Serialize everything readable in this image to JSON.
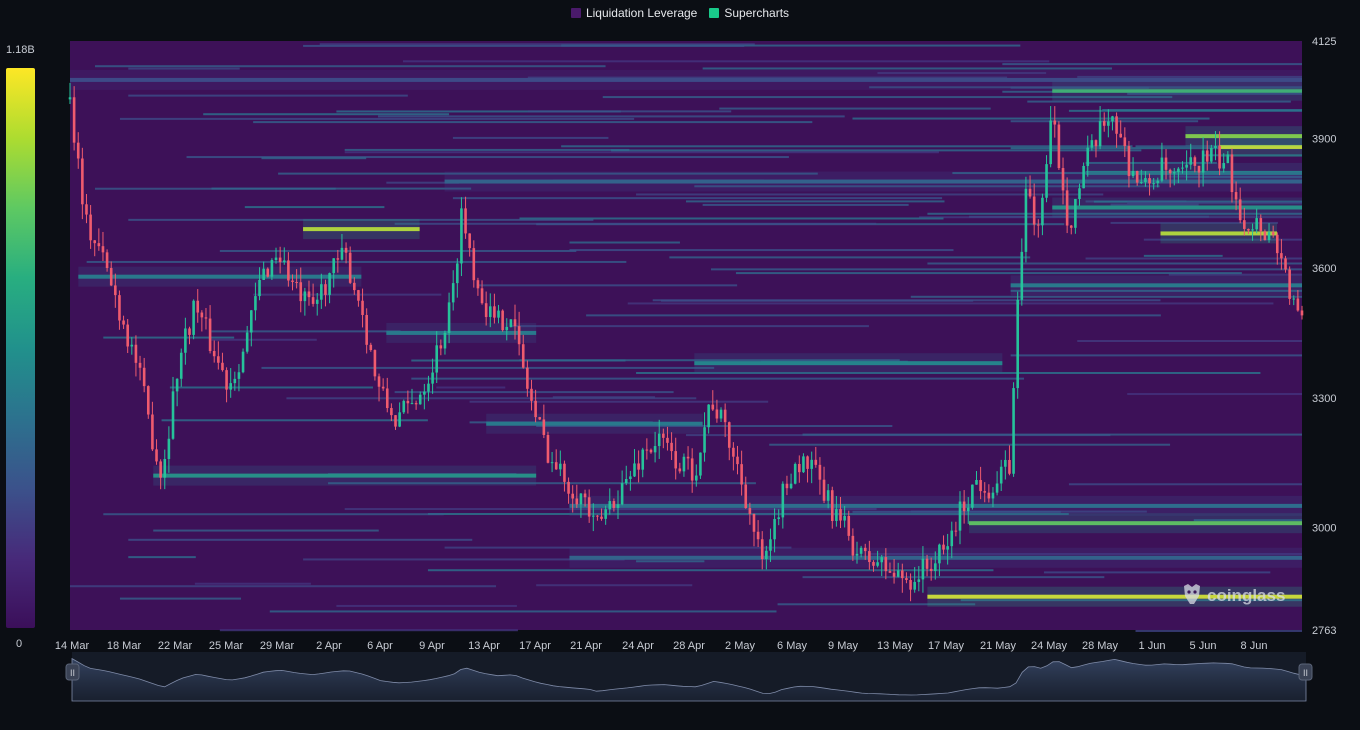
{
  "legend": {
    "items": [
      {
        "label": "Liquidation Leverage",
        "color": "#4a1a6b"
      },
      {
        "label": "Supercharts",
        "color": "#19c98a"
      }
    ]
  },
  "colorbar": {
    "max_label": "1.18B",
    "min_label": "0",
    "stops": [
      "#3b0f5a",
      "#472a7a",
      "#3b528b",
      "#2c728e",
      "#21918c",
      "#28ae80",
      "#5ec962",
      "#addc30",
      "#fde725"
    ]
  },
  "watermark": "coinglass",
  "navigator": {
    "left_handle": "II",
    "right_handle": "II"
  },
  "chart_data": {
    "type": "heatmap",
    "title": "",
    "ylim": [
      2763,
      4125
    ],
    "y_ticks": [
      "4125",
      "3900",
      "3600",
      "3300",
      "3000",
      "2763"
    ],
    "x_ticks": [
      "14 Mar",
      "18 Mar",
      "22 Mar",
      "25 Mar",
      "29 Mar",
      "2 Apr",
      "6 Apr",
      "9 Apr",
      "13 Apr",
      "17 Apr",
      "21 Apr",
      "24 Apr",
      "28 Apr",
      "2 May",
      "6 May",
      "9 May",
      "13 May",
      "17 May",
      "21 May",
      "24 May",
      "28 May",
      "1 Jun",
      "5 Jun",
      "8 Jun"
    ],
    "price_path": [
      [
        0,
        3990
      ],
      [
        2,
        3700
      ],
      [
        4,
        3620
      ],
      [
        6,
        3500
      ],
      [
        8,
        3380
      ],
      [
        10,
        3200
      ],
      [
        11,
        3120
      ],
      [
        13,
        3380
      ],
      [
        15,
        3520
      ],
      [
        17,
        3420
      ],
      [
        19,
        3330
      ],
      [
        21,
        3420
      ],
      [
        23,
        3580
      ],
      [
        25,
        3640
      ],
      [
        27,
        3550
      ],
      [
        29,
        3500
      ],
      [
        31,
        3580
      ],
      [
        33,
        3630
      ],
      [
        35,
        3510
      ],
      [
        37,
        3320
      ],
      [
        39,
        3250
      ],
      [
        41,
        3280
      ],
      [
        43,
        3350
      ],
      [
        45,
        3460
      ],
      [
        46,
        3540
      ],
      [
        47,
        3730
      ],
      [
        49,
        3560
      ],
      [
        51,
        3470
      ],
      [
        53,
        3500
      ],
      [
        54,
        3400
      ],
      [
        56,
        3250
      ],
      [
        58,
        3150
      ],
      [
        60,
        3100
      ],
      [
        62,
        3060
      ],
      [
        63,
        2990
      ],
      [
        65,
        3060
      ],
      [
        67,
        3110
      ],
      [
        69,
        3180
      ],
      [
        71,
        3200
      ],
      [
        73,
        3150
      ],
      [
        75,
        3130
      ],
      [
        77,
        3300
      ],
      [
        79,
        3210
      ],
      [
        81,
        3090
      ],
      [
        83,
        2920
      ],
      [
        84,
        2930
      ],
      [
        85,
        3040
      ],
      [
        87,
        3150
      ],
      [
        89,
        3140
      ],
      [
        91,
        3060
      ],
      [
        93,
        3000
      ],
      [
        95,
        2930
      ],
      [
        97,
        2920
      ],
      [
        99,
        2890
      ],
      [
        101,
        2880
      ],
      [
        103,
        2910
      ],
      [
        105,
        2940
      ],
      [
        107,
        3040
      ],
      [
        109,
        3110
      ],
      [
        111,
        3090
      ],
      [
        113,
        3150
      ],
      [
        114,
        3590
      ],
      [
        115,
        3800
      ],
      [
        116,
        3680
      ],
      [
        117,
        3780
      ],
      [
        118,
        3950
      ],
      [
        120,
        3700
      ],
      [
        122,
        3840
      ],
      [
        124,
        3920
      ],
      [
        125,
        3970
      ],
      [
        127,
        3850
      ],
      [
        129,
        3780
      ],
      [
        131,
        3830
      ],
      [
        133,
        3800
      ],
      [
        135,
        3840
      ],
      [
        137,
        3860
      ],
      [
        139,
        3840
      ],
      [
        141,
        3710
      ],
      [
        143,
        3700
      ],
      [
        145,
        3660
      ],
      [
        147,
        3510
      ],
      [
        148,
        3470
      ]
    ],
    "liquidation_levels": [
      {
        "price": 3880,
        "day_from": 138,
        "day_to": 148,
        "intensity": 0.98
      },
      {
        "price": 3905,
        "day_from": 134,
        "day_to": 148,
        "intensity": 0.85
      },
      {
        "price": 3690,
        "day_from": 28,
        "day_to": 42,
        "intensity": 0.95
      },
      {
        "price": 3680,
        "day_from": 131,
        "day_to": 145,
        "intensity": 0.95
      },
      {
        "price": 2840,
        "day_from": 103,
        "day_to": 148,
        "intensity": 1.0
      },
      {
        "price": 3010,
        "day_from": 108,
        "day_to": 148,
        "intensity": 0.78
      },
      {
        "price": 4010,
        "day_from": 118,
        "day_to": 148,
        "intensity": 0.7
      },
      {
        "price": 3740,
        "day_from": 118,
        "day_to": 148,
        "intensity": 0.55
      },
      {
        "price": 3820,
        "day_from": 122,
        "day_to": 148,
        "intensity": 0.5
      },
      {
        "price": 3120,
        "day_from": 10,
        "day_to": 56,
        "intensity": 0.55
      },
      {
        "price": 3240,
        "day_from": 50,
        "day_to": 76,
        "intensity": 0.45
      },
      {
        "price": 3380,
        "day_from": 75,
        "day_to": 112,
        "intensity": 0.5
      },
      {
        "price": 3580,
        "day_from": 1,
        "day_to": 35,
        "intensity": 0.45
      },
      {
        "price": 3800,
        "day_from": 45,
        "day_to": 148,
        "intensity": 0.35
      },
      {
        "price": 3450,
        "day_from": 38,
        "day_to": 56,
        "intensity": 0.45
      },
      {
        "price": 3050,
        "day_from": 60,
        "day_to": 148,
        "intensity": 0.4
      },
      {
        "price": 2930,
        "day_from": 60,
        "day_to": 148,
        "intensity": 0.35
      },
      {
        "price": 3560,
        "day_from": 113,
        "day_to": 148,
        "intensity": 0.45
      },
      {
        "price": 4035,
        "day_from": 0,
        "day_to": 148,
        "intensity": 0.25
      }
    ]
  }
}
